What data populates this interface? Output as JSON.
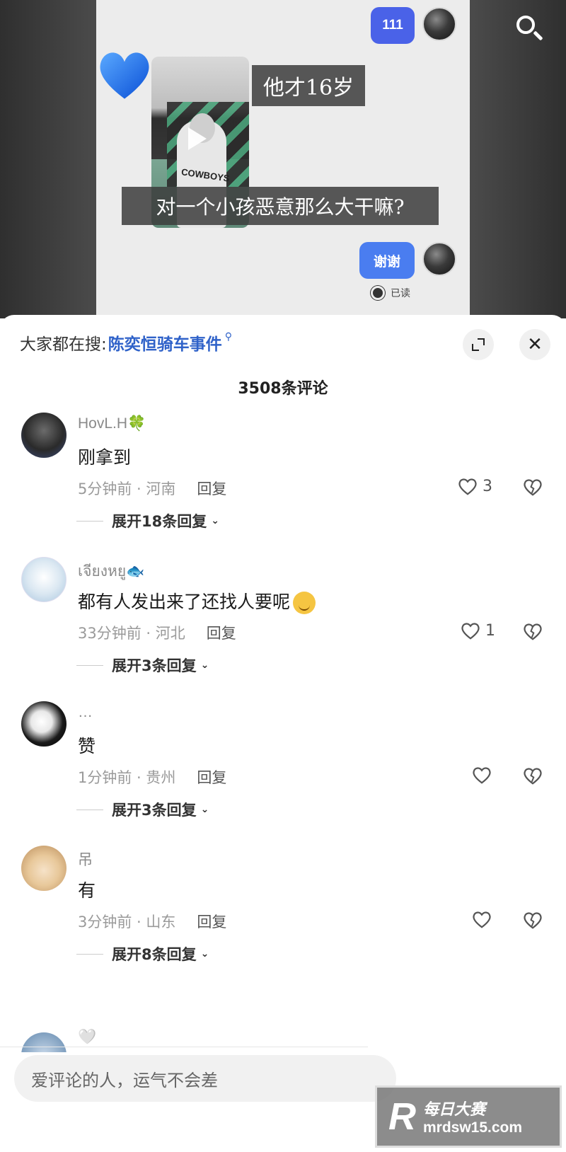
{
  "video": {
    "bubble_top": "111",
    "caption_1": "他才16岁",
    "caption_2": "对一个小孩恶意那么大干嘛?",
    "jersey_text": "COWBOYS",
    "bubble_reply": "谢谢",
    "read_status": "已读"
  },
  "panel": {
    "trending_prefix": "大家都在搜:",
    "trending_topic": "陈奕恒骑车事件",
    "comment_count_title": "3508条评论",
    "input_placeholder": "爱评论的人，运气不会差"
  },
  "comments": [
    {
      "username": "HovL.H🍀",
      "text": "刚拿到",
      "time": "5分钟前 · 河南",
      "reply": "回复",
      "likes": "3",
      "expand": "展开18条回复"
    },
    {
      "username": "เจียงหยู🐟",
      "text": "都有人发出来了还找人要呢",
      "time": "33分钟前 · 河北",
      "reply": "回复",
      "likes": "1",
      "expand": "展开3条回复"
    },
    {
      "username": "…",
      "text": "赞",
      "time": "1分钟前 · 贵州",
      "reply": "回复",
      "likes": "",
      "expand": "展开3条回复"
    },
    {
      "username": "吊",
      "text": "有",
      "time": "3分钟前 · 山东",
      "reply": "回复",
      "likes": "",
      "expand": "展开8条回复"
    },
    {
      "username": "🤍"
    }
  ],
  "watermark": {
    "logo": "R",
    "name": "每日大赛",
    "url": "mrdsw15.com"
  },
  "colors": {
    "accent_blue": "#2f62c9",
    "bubble_blue": "#4a7df0"
  }
}
